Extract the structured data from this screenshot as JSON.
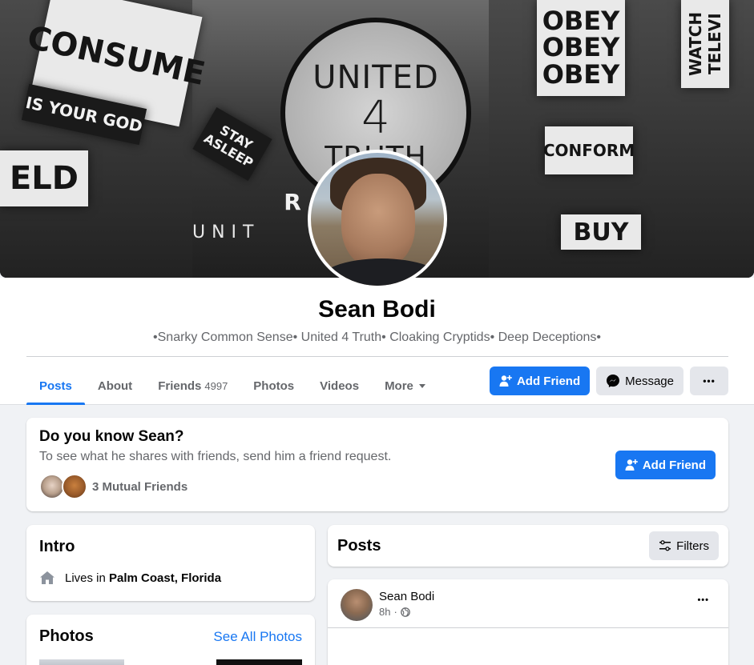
{
  "cover": {
    "signs": [
      "CONSUME",
      "IS YOUR GOD",
      "ELD",
      "STAY ASLEEP",
      "OBEY",
      "OBEY",
      "OBEY",
      "WATCH TELEVI",
      "CONFORM",
      "BUY",
      "R"
    ],
    "logo_line1": "UNITED",
    "logo_line2": "4",
    "logo_line3": "TRUTH",
    "band_text": "UNIT        RUTH"
  },
  "profile": {
    "name": "Sean Bodi",
    "bio": "•Snarky Common Sense• United 4 Truth• Cloaking Cryptids• Deep Deceptions•"
  },
  "tabs": [
    {
      "label": "Posts",
      "count": ""
    },
    {
      "label": "About",
      "count": ""
    },
    {
      "label": "Friends",
      "count": "4997"
    },
    {
      "label": "Photos",
      "count": ""
    },
    {
      "label": "Videos",
      "count": ""
    },
    {
      "label": "More",
      "count": ""
    }
  ],
  "actions": {
    "add_friend": "Add Friend",
    "message": "Message",
    "more": "•••"
  },
  "know": {
    "title": "Do you know Sean?",
    "subtitle": "To see what he shares with friends, send him a friend request.",
    "mutual": "3 Mutual Friends",
    "add_friend": "Add Friend"
  },
  "intro": {
    "title": "Intro",
    "lives_prefix": "Lives in",
    "lives_place": "Palm Coast, Florida"
  },
  "photos": {
    "title": "Photos",
    "see_all": "See All Photos"
  },
  "posts": {
    "title": "Posts",
    "filters": "Filters",
    "author": "Sean Bodi",
    "time": "8h",
    "more": "•••"
  },
  "colors": {
    "accent": "#1877f2",
    "secondary_text": "#65676b",
    "page_bg": "#f0f2f5"
  }
}
